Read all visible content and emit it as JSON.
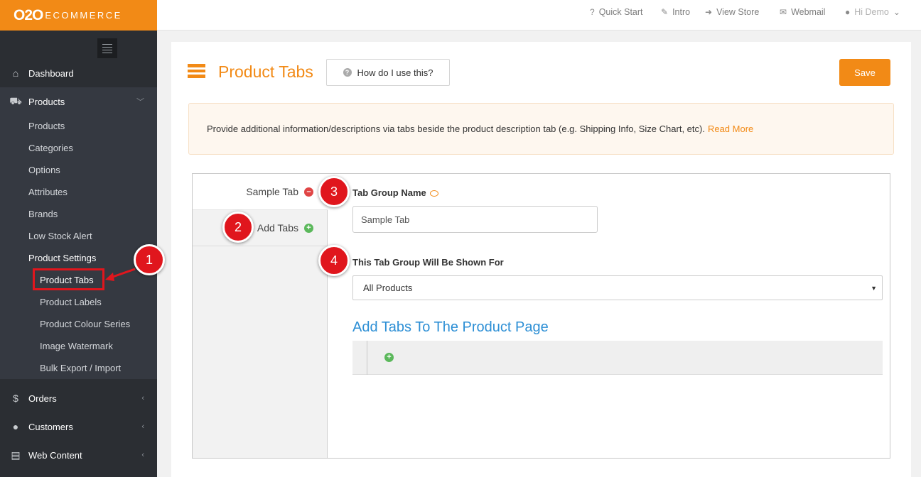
{
  "logo": {
    "mark": "O2O",
    "word": "ECOMMERCE"
  },
  "topbar": {
    "quick_start": "Quick Start",
    "intro": "Intro",
    "view_store": "View Store",
    "webmail": "Webmail",
    "user": "Hi Demo"
  },
  "sidebar": {
    "dashboard": "Dashboard",
    "products": "Products",
    "products_sub": [
      "Products",
      "Categories",
      "Options",
      "Attributes",
      "Brands",
      "Low Stock Alert"
    ],
    "product_settings": "Product Settings",
    "settings_sub": [
      "Product Tabs",
      "Product Labels",
      "Product Colour Series",
      "Image Watermark",
      "Bulk Export / Import"
    ],
    "orders": "Orders",
    "customers": "Customers",
    "web_content": "Web Content"
  },
  "page": {
    "title": "Product Tabs",
    "help": "How do I use this?",
    "save": "Save",
    "info": "Provide additional information/descriptions via tabs beside the product description tab (e.g. Shipping Info, Size Chart, etc).",
    "read_more": "Read More"
  },
  "tabs": {
    "sample": "Sample Tab",
    "add": "Add Tabs"
  },
  "form": {
    "group_name_label": "Tab Group Name",
    "group_name_value": "Sample Tab",
    "shown_for_label": "This Tab Group Will Be Shown For",
    "shown_for_value": "All Products",
    "section_title": "Add Tabs To The Product Page"
  },
  "annotations": [
    "1",
    "2",
    "3",
    "4"
  ],
  "colors": {
    "accent": "#f28a16",
    "sidebar": "#2b2e33",
    "link": "#2d8fd5",
    "annotation": "#e0161d"
  }
}
